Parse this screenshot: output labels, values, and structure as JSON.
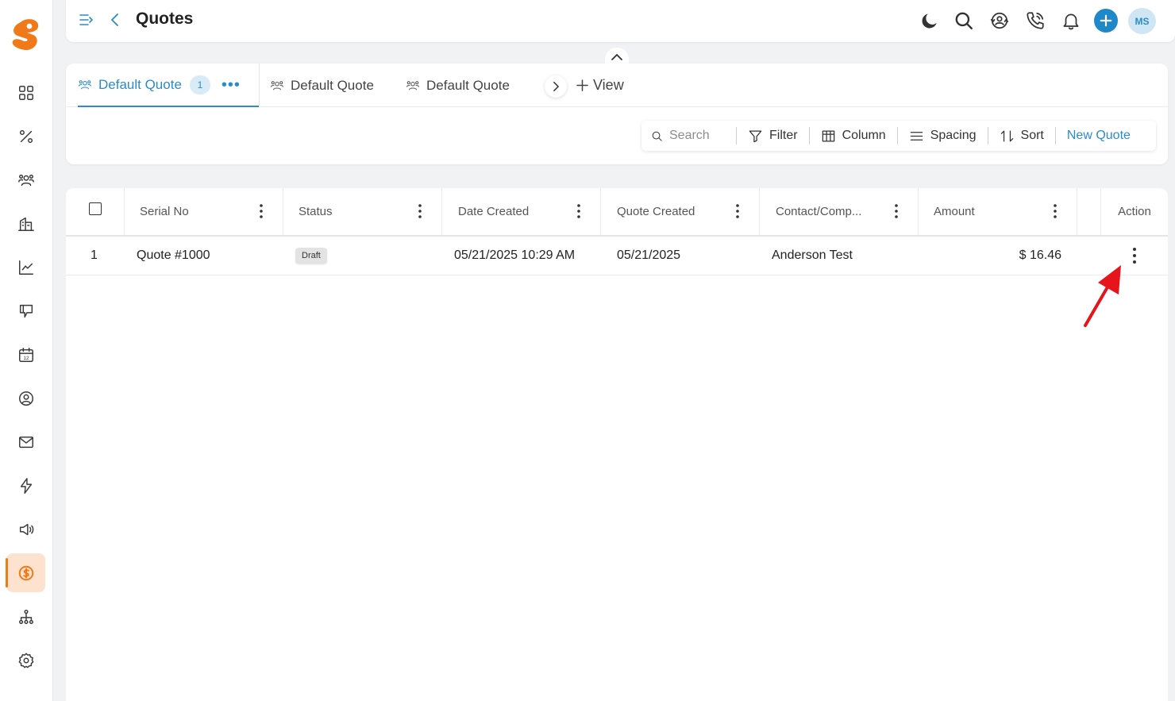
{
  "app": {
    "brand_color": "#f07a1a",
    "accent_color": "#2a8cc9"
  },
  "header": {
    "title": "Quotes",
    "avatar_initials": "MS",
    "icons": [
      "moon-icon",
      "search-icon",
      "support-icon",
      "phone-icon",
      "bell-icon",
      "plus-icon"
    ]
  },
  "sidebar": {
    "items": [
      {
        "icon": "dashboard-icon"
      },
      {
        "icon": "percent-icon"
      },
      {
        "icon": "contacts-icon"
      },
      {
        "icon": "company-icon"
      },
      {
        "icon": "analytics-icon"
      },
      {
        "icon": "feedback-icon"
      },
      {
        "icon": "calendar-icon"
      },
      {
        "icon": "profile-icon"
      },
      {
        "icon": "mail-icon"
      },
      {
        "icon": "automation-icon"
      },
      {
        "icon": "campaign-icon"
      },
      {
        "icon": "sales-icon",
        "active": true
      },
      {
        "icon": "hierarchy-icon"
      },
      {
        "icon": "settings-icon"
      }
    ]
  },
  "views": {
    "tabs": [
      {
        "label": "Default Quote",
        "count": "1",
        "active": true
      },
      {
        "label": "Default Quote"
      },
      {
        "label": "Default Quote"
      }
    ],
    "add_view_label": "View"
  },
  "toolbar": {
    "search_placeholder": "Search",
    "filter_label": "Filter",
    "column_label": "Column",
    "spacing_label": "Spacing",
    "sort_label": "Sort",
    "new_label": "New Quote"
  },
  "table": {
    "columns": [
      "Serial No",
      "Status",
      "Date Created",
      "Quote Created",
      "Contact/Comp...",
      "Amount",
      "Action"
    ],
    "rows": [
      {
        "index": "1",
        "serial": "Quote #1000",
        "status": "Draft",
        "date_created": "05/21/2025 10:29 AM",
        "quote_created": "05/21/2025",
        "contact": "Anderson Test",
        "amount": "$ 16.46"
      }
    ]
  }
}
